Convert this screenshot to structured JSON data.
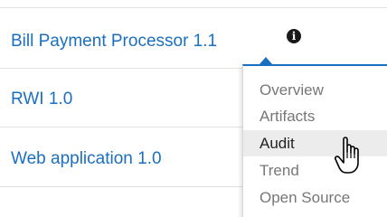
{
  "applications": [
    {
      "name": "Bill Payment Processor 1.1"
    },
    {
      "name": "RWI 1.0"
    },
    {
      "name": "Web application 1.0"
    }
  ],
  "info_icon": {
    "icon": "info-icon",
    "glyph": "i"
  },
  "menu": {
    "items": [
      {
        "label": "Overview"
      },
      {
        "label": "Artifacts"
      },
      {
        "label": "Audit"
      },
      {
        "label": "Trend"
      },
      {
        "label": "Open Source"
      }
    ],
    "hovered": "Audit"
  },
  "colors": {
    "link": "#1b6fc0",
    "menu_accent": "#1b6fc0",
    "menu_text": "#777777",
    "menu_hover_bg": "#ececec"
  }
}
